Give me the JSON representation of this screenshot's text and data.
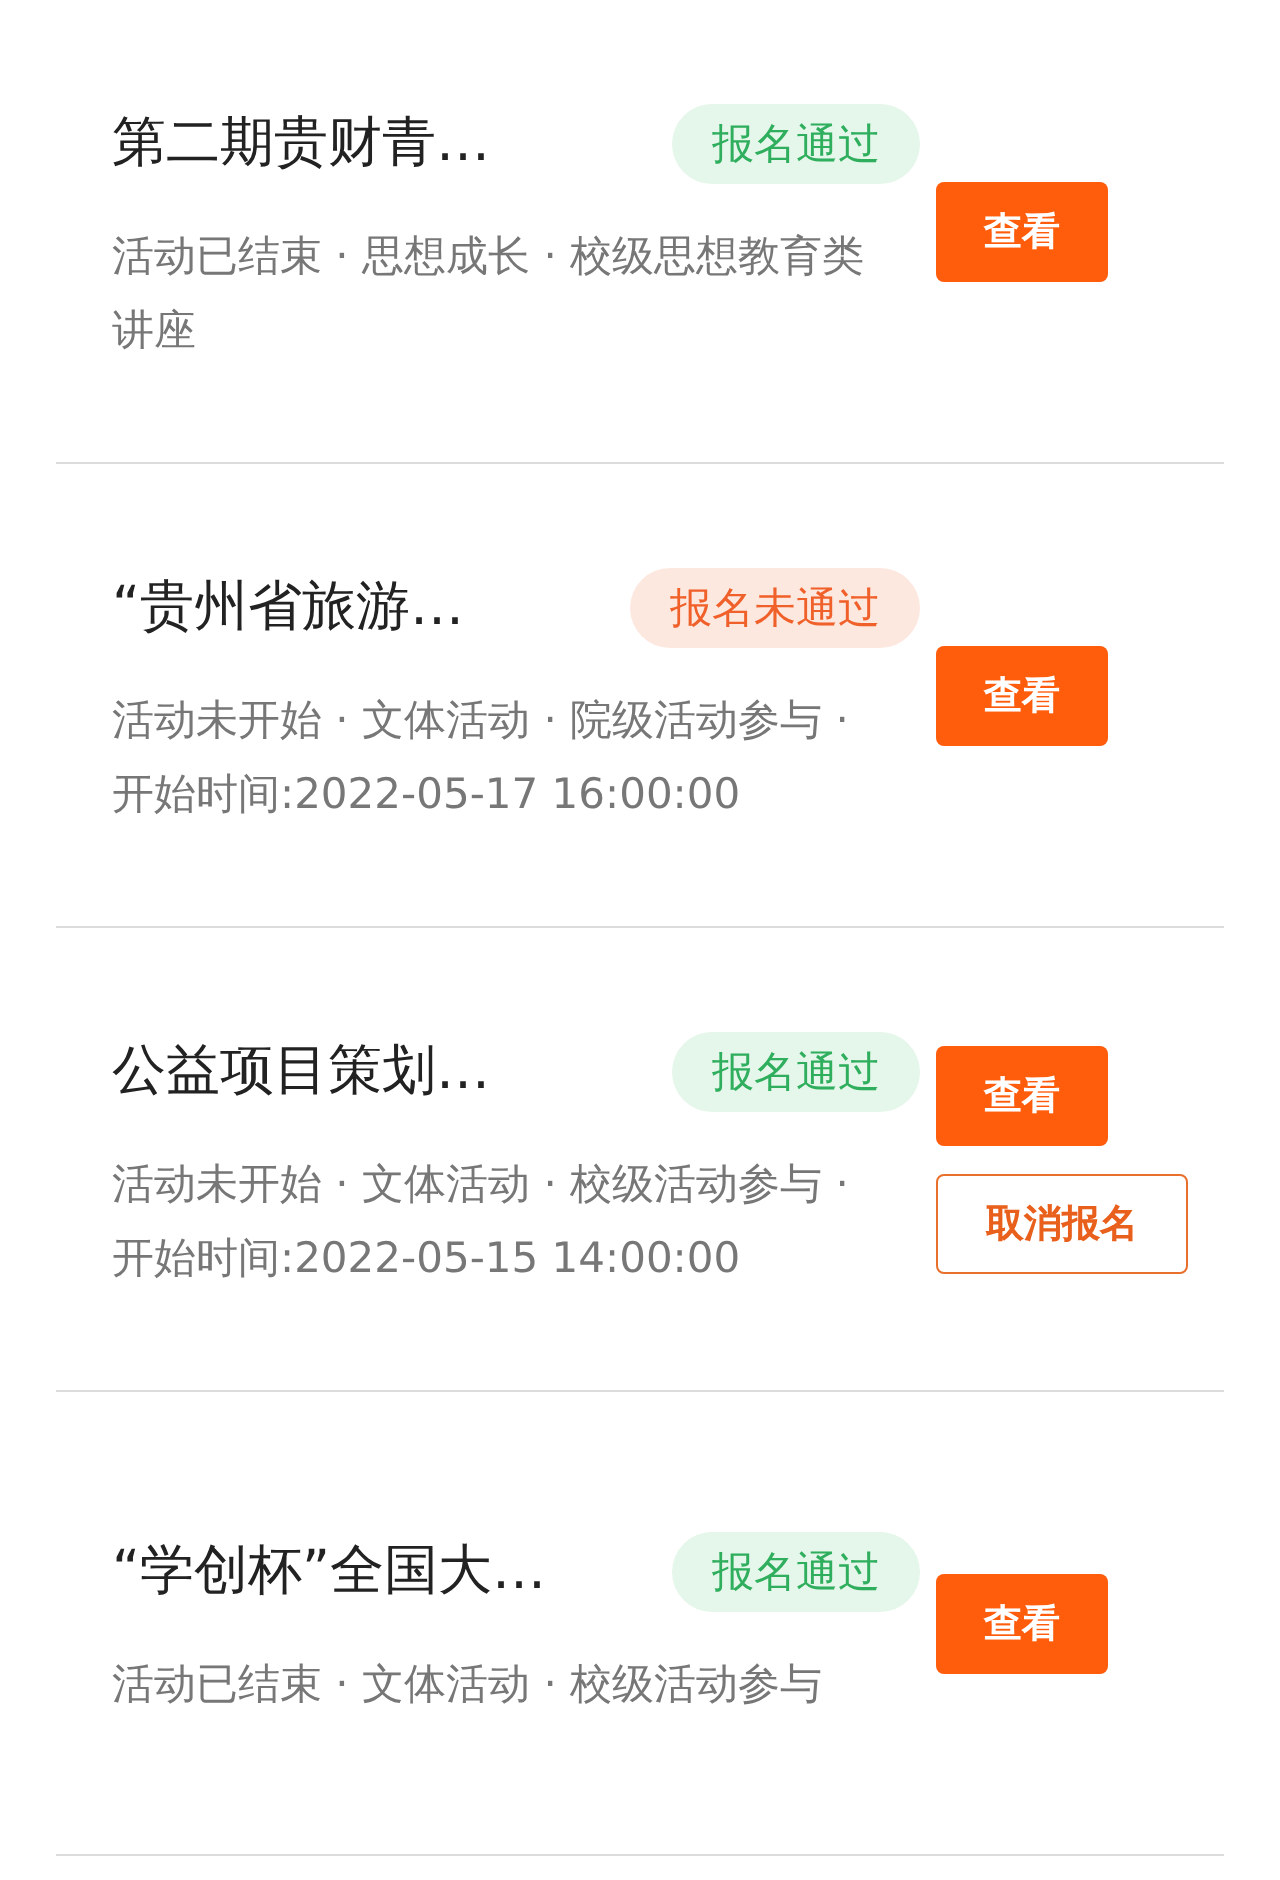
{
  "activities": [
    {
      "title": "第二期贵财青…",
      "status": {
        "label": "报名通过",
        "kind": "pass"
      },
      "description": "活动已结束 · 思想成长 · 校级思想教育类讲座",
      "buttons": [
        {
          "label": "查看",
          "kind": "primary"
        }
      ]
    },
    {
      "title": "“贵州省旅游…",
      "status": {
        "label": "报名未通过",
        "kind": "fail"
      },
      "description": "活动未开始 · 文体活动 · 院级活动参与 · 开始时间:2022-05-17 16:00:00",
      "buttons": [
        {
          "label": "查看",
          "kind": "primary"
        }
      ]
    },
    {
      "title": "公益项目策划…",
      "status": {
        "label": "报名通过",
        "kind": "pass"
      },
      "description": "活动未开始 · 文体活动 · 校级活动参与 · 开始时间:2022-05-15 14:00:00",
      "buttons": [
        {
          "label": "查看",
          "kind": "primary"
        },
        {
          "label": "取消报名",
          "kind": "outline"
        }
      ]
    },
    {
      "title": "“学创杯”全国大…",
      "status": {
        "label": "报名通过",
        "kind": "pass"
      },
      "description": "活动已结束 · 文体活动 · 校级活动参与",
      "buttons": [
        {
          "label": "查看",
          "kind": "primary"
        }
      ]
    }
  ]
}
